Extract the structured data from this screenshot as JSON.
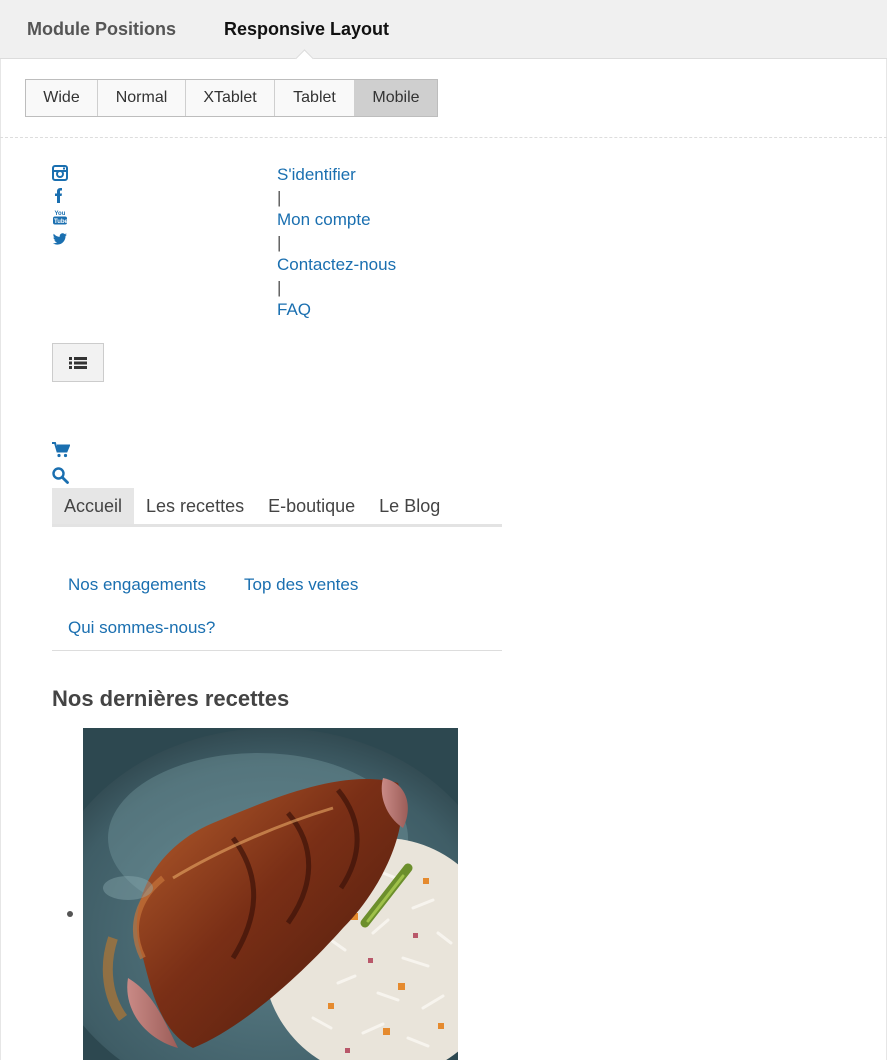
{
  "tabs": {
    "module_positions": "Module Positions",
    "responsive_layout": "Responsive Layout"
  },
  "layouts": [
    {
      "label": "Wide",
      "active": false
    },
    {
      "label": "Normal",
      "active": false
    },
    {
      "label": "XTablet",
      "active": false
    },
    {
      "label": "Tablet",
      "active": false
    },
    {
      "label": "Mobile",
      "active": true
    }
  ],
  "social_icons": [
    "instagram-icon",
    "facebook-icon",
    "youtube-icon",
    "twitter-icon"
  ],
  "header_links": {
    "login": "S'identifier",
    "account": "Mon compte",
    "contact": "Contactez-nous",
    "faq": "FAQ",
    "separator": "|"
  },
  "toolbar_icons": [
    "menu-list-icon",
    "cart-icon",
    "search-icon"
  ],
  "nav": {
    "home": "Accueil",
    "recipes": "Les recettes",
    "shop": "E-boutique",
    "blog": "Le Blog"
  },
  "subnav": {
    "commitments": "Nos engagements",
    "bestsellers": "Top des ventes",
    "about": "Qui sommes-nous?"
  },
  "section": {
    "title": "Nos dernières recettes"
  },
  "colors": {
    "link": "#1a6fb0",
    "active_segment": "#cfcfcf",
    "top_bar": "#f0f0f0"
  }
}
